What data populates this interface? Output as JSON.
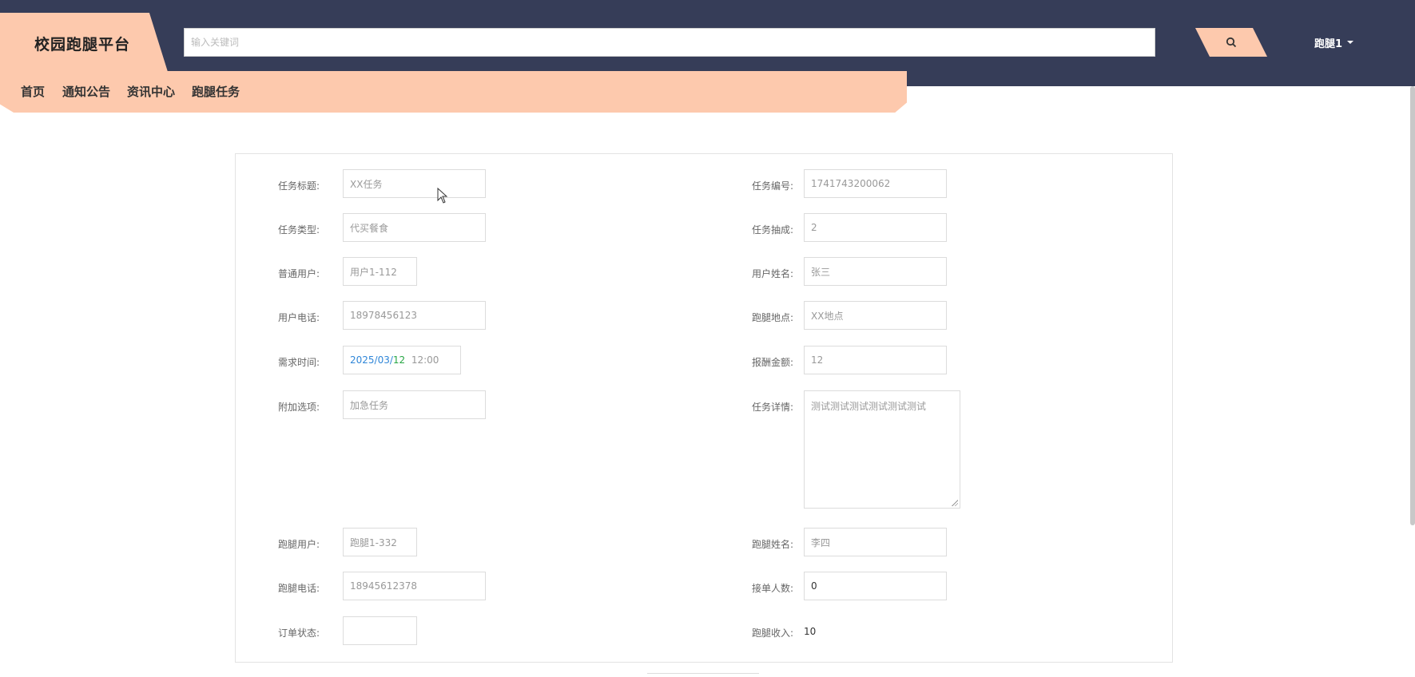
{
  "header": {
    "brand": "校园跑腿平台",
    "search_placeholder": "输入关键词",
    "user": "跑腿1"
  },
  "nav": [
    "首页",
    "通知公告",
    "资讯中心",
    "跑腿任务"
  ],
  "form": {
    "task_title_label": "任务标题:",
    "task_title": "XX任务",
    "task_no_label": "任务编号:",
    "task_no": "1741743200062",
    "task_type_label": "任务类型:",
    "task_type": "代买餐食",
    "commission_label": "任务抽成:",
    "commission": "2",
    "user_label": "普通用户:",
    "user": "用户1-112",
    "user_name_label": "用户姓名:",
    "user_name": "张三",
    "user_phone_label": "用户电话:",
    "user_phone": "18978456123",
    "location_label": "跑腿地点:",
    "location": "XX地点",
    "time_label": "需求时间:",
    "time_date_a": "2025/03/",
    "time_date_b": "12",
    "time_clock": "12:00",
    "reward_label": "报酬金额:",
    "reward": "12",
    "extra_label": "附加选项:",
    "extra": "加急任务",
    "detail_label": "任务详情:",
    "detail": "测试测试测试测试测试测试",
    "runner_label": "跑腿用户:",
    "runner": "跑腿1-332",
    "runner_name_label": "跑腿姓名:",
    "runner_name": "李四",
    "runner_phone_label": "跑腿电话:",
    "runner_phone": "18945612378",
    "accept_count_label": "接单人数:",
    "accept_count": "0",
    "status_label": "订单状态:",
    "status": "",
    "income_label": "跑腿收入:",
    "income": "10"
  },
  "colors": {
    "header_bg": "#363d58",
    "accent": "#fdc9ad"
  }
}
